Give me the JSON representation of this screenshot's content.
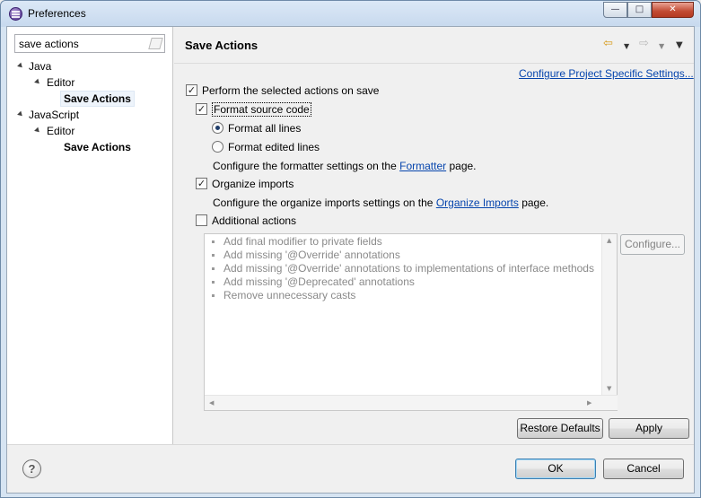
{
  "window": {
    "title": "Preferences",
    "controls": {
      "minimize": "—",
      "maximize": "□",
      "close": "✕"
    }
  },
  "filter": {
    "value": "save actions"
  },
  "tree": [
    {
      "label": "Java",
      "depth": 0,
      "expanded": true
    },
    {
      "label": "Editor",
      "depth": 1,
      "expanded": true
    },
    {
      "label": "Save Actions",
      "depth": 2,
      "selected": true
    },
    {
      "label": "JavaScript",
      "depth": 0,
      "expanded": true
    },
    {
      "label": "Editor",
      "depth": 1,
      "expanded": true
    },
    {
      "label": "Save Actions",
      "depth": 2,
      "selected": false
    }
  ],
  "page": {
    "title": "Save Actions",
    "configure_link": "Configure Project Specific Settings...",
    "perform_label": "Perform the selected actions on save",
    "format_label": "Format source code",
    "format_all_label": "Format all lines",
    "format_edited_label": "Format edited lines",
    "formatter_text_pre": "Configure the formatter settings on the ",
    "formatter_link": "Formatter",
    "formatter_text_post": " page.",
    "organize_label": "Organize imports",
    "organize_text_pre": "Configure the organize imports settings on the ",
    "organize_link": "Organize Imports",
    "organize_text_post": " page.",
    "additional_label": "Additional actions",
    "additional_items": [
      "Add final modifier to private fields",
      "Add missing '@Override' annotations",
      "Add missing '@Override' annotations to implementations of interface methods",
      "Add missing '@Deprecated' annotations",
      "Remove unnecessary casts"
    ],
    "configure_button": "Configure...",
    "restore_button": "Restore Defaults",
    "apply_button": "Apply"
  },
  "checks": {
    "perform": true,
    "format": true,
    "format_all": true,
    "format_edited": false,
    "organize": true,
    "additional": false
  },
  "footer": {
    "ok": "OK",
    "cancel": "Cancel",
    "help": "?"
  }
}
